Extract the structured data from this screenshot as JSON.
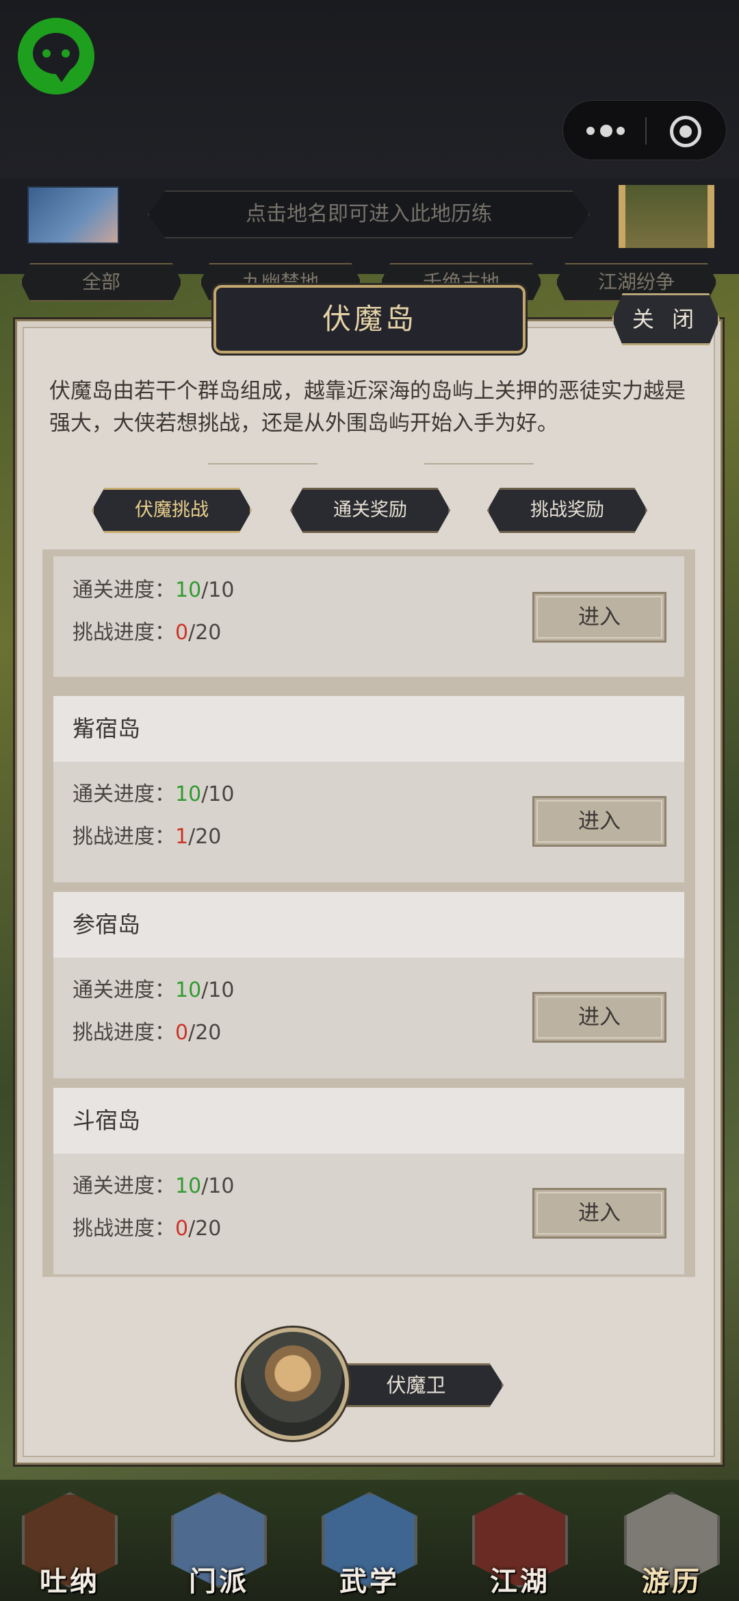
{
  "header": {
    "hint_text": "点击地名即可进入此地历练",
    "map_tabs": [
      "全部",
      "九幽禁地",
      "千绝古地",
      "江湖纷争"
    ]
  },
  "dialog": {
    "title": "伏魔岛",
    "close_label": "关 闭",
    "description": "伏魔岛由若干个群岛组成，越靠近深海的岛屿上关押的恶徒实力越是强大，大侠若想挑战，还是从外围岛屿开始入手为好。",
    "tabs": [
      {
        "label": "伏魔挑战",
        "active": true
      },
      {
        "label": "通关奖励",
        "active": false
      },
      {
        "label": "挑战奖励",
        "active": false
      }
    ],
    "progress_label_clear": "通关进度：",
    "progress_label_challenge": "挑战进度：",
    "enter_label": "进入",
    "islands": [
      {
        "name": "",
        "clear_done": "10",
        "clear_total": "/10",
        "challenge_done": "0",
        "challenge_total": "/20"
      },
      {
        "name": "觜宿岛",
        "clear_done": "10",
        "clear_total": "/10",
        "challenge_done": "1",
        "challenge_total": "/20"
      },
      {
        "name": "参宿岛",
        "clear_done": "10",
        "clear_total": "/10",
        "challenge_done": "0",
        "challenge_total": "/20"
      },
      {
        "name": "斗宿岛",
        "clear_done": "10",
        "clear_total": "/10",
        "challenge_done": "0",
        "challenge_total": "/20"
      }
    ],
    "guard_label": "伏魔卫"
  },
  "nav": [
    {
      "label": "吐纳",
      "icon": "meditation-icon",
      "active": false
    },
    {
      "label": "门派",
      "icon": "sect-flag-icon",
      "active": false
    },
    {
      "label": "武学",
      "icon": "martial-book-icon",
      "active": false
    },
    {
      "label": "江湖",
      "icon": "straw-hat-icon",
      "active": false
    },
    {
      "label": "游历",
      "icon": "horse-icon",
      "active": true
    }
  ],
  "colors": {
    "progress_done": "#2f9b2f",
    "challenge_done": "#cc3428",
    "gold": "#c7ad6e"
  }
}
